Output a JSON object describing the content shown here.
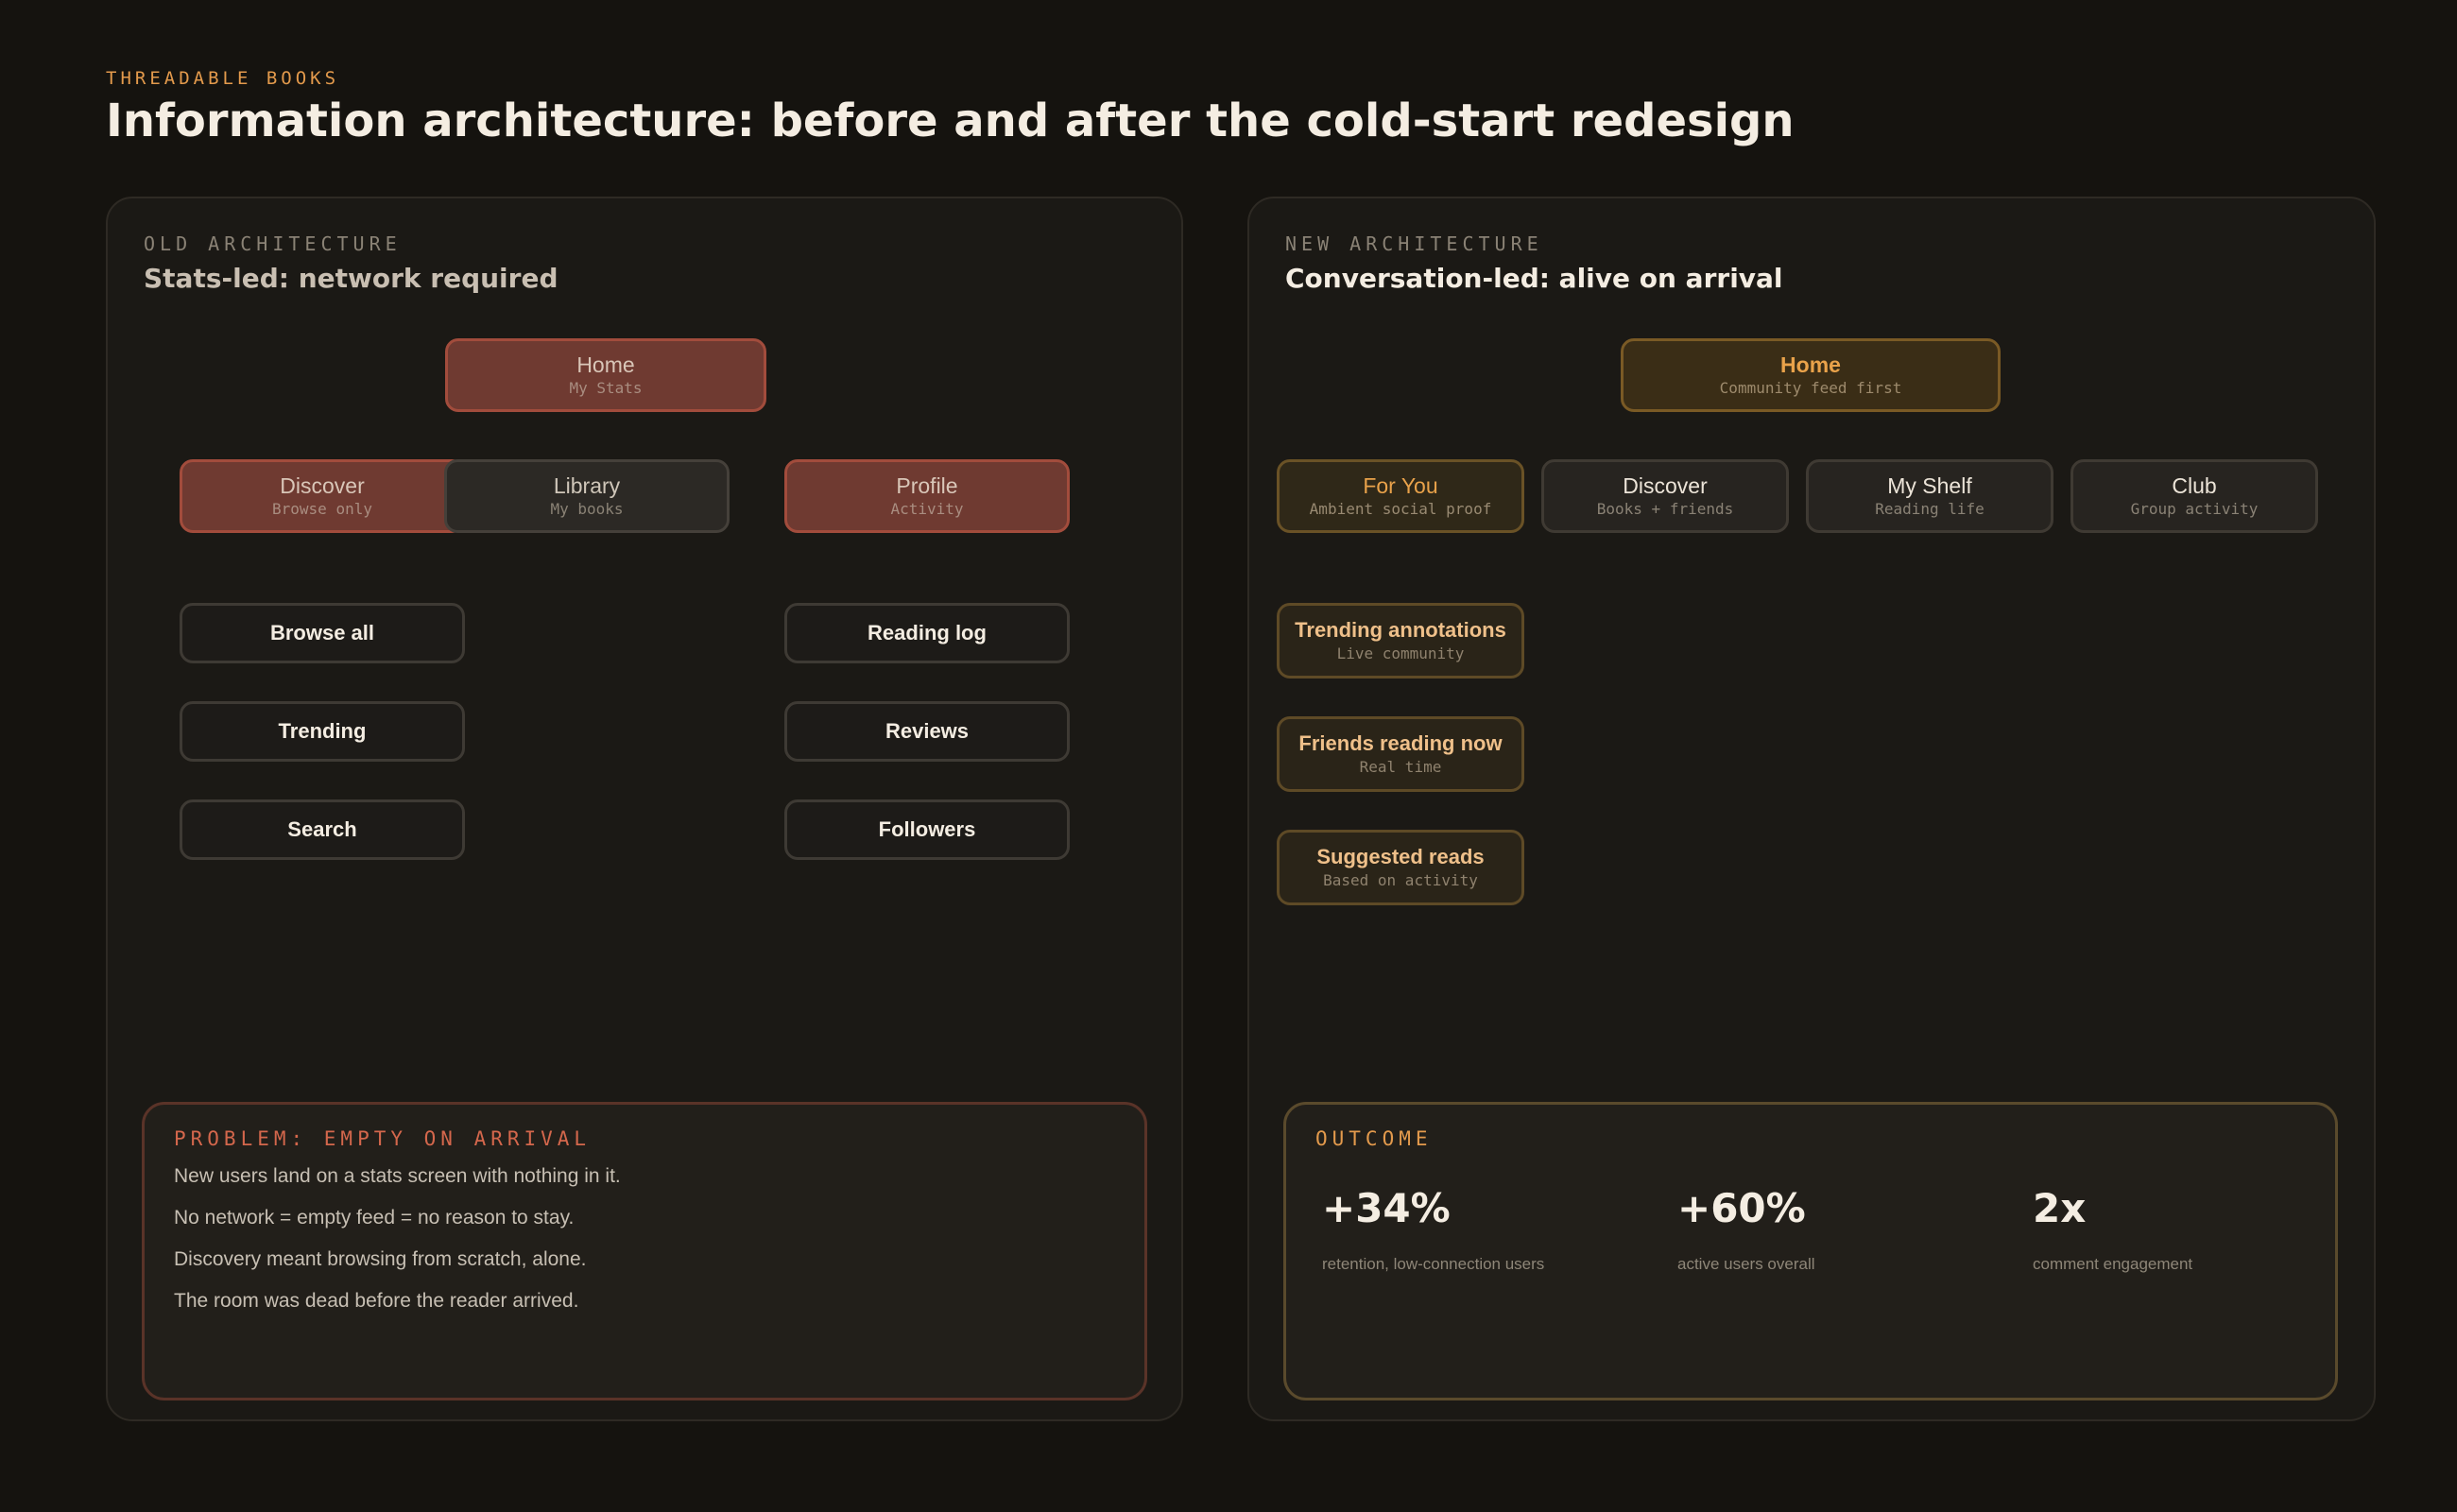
{
  "header": {
    "eyebrow": "THREADABLE BOOKS",
    "title": "Information architecture: before and after the cold-start redesign"
  },
  "old": {
    "eyebrow": "OLD ARCHITECTURE",
    "title": "Stats-led: network required",
    "home": {
      "label": "Home",
      "sub": "My Stats"
    },
    "discover": {
      "label": "Discover",
      "sub": "Browse only"
    },
    "library": {
      "label": "Library",
      "sub": "My books"
    },
    "profile": {
      "label": "Profile",
      "sub": "Activity"
    },
    "discover_children": [
      "Browse all",
      "Trending",
      "Search"
    ],
    "profile_children": [
      "Reading log",
      "Reviews",
      "Followers"
    ],
    "problem": {
      "eyebrow": "PROBLEM: EMPTY ON ARRIVAL",
      "lines": [
        "New users land on a stats screen with nothing in it.",
        "No network = empty feed = no reason to stay.",
        "Discovery meant browsing from scratch, alone.",
        "The room was dead before the reader arrived."
      ]
    }
  },
  "new": {
    "eyebrow": "NEW ARCHITECTURE",
    "title": "Conversation-led: alive on arrival",
    "home": {
      "label": "Home",
      "sub": "Community feed first"
    },
    "tabs": [
      {
        "label": "For You",
        "sub": "Ambient social proof"
      },
      {
        "label": "Discover",
        "sub": "Books + friends"
      },
      {
        "label": "My Shelf",
        "sub": "Reading life"
      },
      {
        "label": "Club",
        "sub": "Group activity"
      }
    ],
    "foryou_children": [
      {
        "label": "Trending annotations",
        "sub": "Live community"
      },
      {
        "label": "Friends reading now",
        "sub": "Real time"
      },
      {
        "label": "Suggested reads",
        "sub": "Based on activity"
      }
    ],
    "outcome": {
      "eyebrow": "OUTCOME",
      "stats": [
        {
          "value": "+34%",
          "label": "retention, low-connection users"
        },
        {
          "value": "+60%",
          "label": "active users overall"
        },
        {
          "value": "2x",
          "label": "comment engagement"
        }
      ]
    }
  },
  "colors": {
    "accent": "#e39a4c",
    "old_highlight": "#a24c3c",
    "new_highlight": "#e9a24a"
  }
}
